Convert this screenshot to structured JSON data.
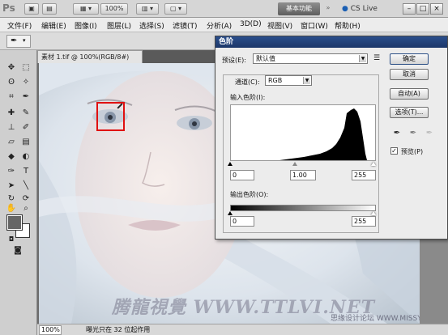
{
  "app": {
    "logo": "Ps",
    "zoom_label": "100%",
    "workspace_button": "基本功能",
    "cs_live": "CS Live",
    "min_label": "–",
    "max_label": "□",
    "close_label": "×"
  },
  "menu": [
    "文件(F)",
    "编辑(E)",
    "图像(I)",
    "图层(L)",
    "选择(S)",
    "滤镜(T)",
    "分析(A)",
    "3D(D)",
    "视图(V)",
    "窗口(W)",
    "帮助(H)"
  ],
  "document": {
    "tab_title": "素材 1.tif @ 100%(RGB/8#)",
    "status_zoom": "100%",
    "status_info": "曝光只在 32 位起作用",
    "watermark": "腾龍視覺 WWW.TTLVI.NET",
    "watermark2": "思缘设计论坛 WWW.MISSYUAN.COM"
  },
  "levels_dialog": {
    "title": "色阶",
    "preset_label": "预设(E):",
    "preset_value": "默认值",
    "channel_label": "通道(C):",
    "channel_value": "RGB",
    "input_levels_label": "输入色阶(I):",
    "input_black": "0",
    "input_gamma": "1.00",
    "input_white": "255",
    "output_levels_label": "输出色阶(O):",
    "output_black": "0",
    "output_white": "255",
    "buttons": {
      "ok": "确定",
      "cancel": "取消",
      "auto": "自动(A)",
      "options": "选项(T)..."
    },
    "preview_label": "预览(P)",
    "preview_checked": true
  },
  "colors": {
    "title_bar": "#1c3769",
    "highlight_box": "#e01010",
    "foreground_swatch": "#666666",
    "background_swatch": "#ffffff"
  },
  "icons": {
    "tools": [
      "move-icon",
      "marquee-icon",
      "lasso-icon",
      "magic-wand-icon",
      "crop-icon",
      "eyedropper-icon",
      "healing-icon",
      "brush-icon",
      "stamp-icon",
      "history-brush-icon",
      "eraser-icon",
      "gradient-icon",
      "blur-icon",
      "dodge-icon",
      "pen-icon",
      "type-icon",
      "path-select-icon",
      "shape-icon",
      "3d-rotate-icon",
      "3d-orbit-icon",
      "hand-icon",
      "zoom-icon"
    ]
  }
}
